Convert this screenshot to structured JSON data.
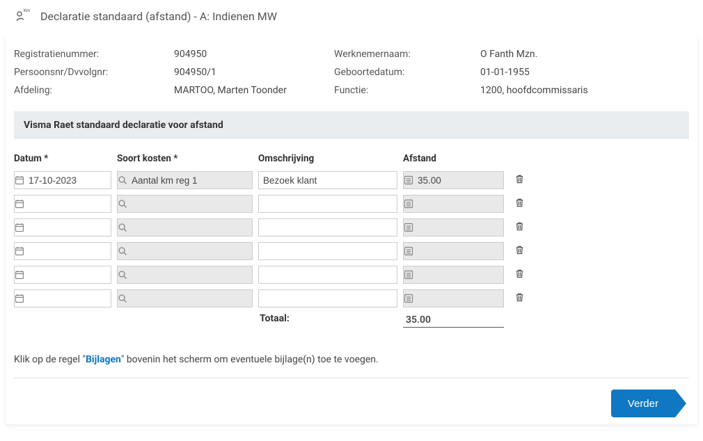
{
  "header": {
    "title": "Declaratie standaard (afstand) - A: Indienen MW"
  },
  "meta": {
    "regnr_label": "Registratienummer:",
    "regnr_value": "904950",
    "persnr_label": "Persoonsnr/Dvvolgnr:",
    "persnr_value": "904950/1",
    "afdeling_label": "Afdeling:",
    "afdeling_value": "MARTOO, Marten Toonder",
    "werknaam_label": "Werknemernaam:",
    "werknaam_value": "O Fanth Mzn.",
    "gebdat_label": "Geboortedatum:",
    "gebdat_value": "01-01-1955",
    "functie_label": "Functie:",
    "functie_value": "1200, hoofdcommissaris"
  },
  "section_title": "Visma Raet standaard declaratie voor afstand",
  "columns": {
    "datum": "Datum *",
    "soort": "Soort kosten *",
    "omschr": "Omschrijving",
    "afstand": "Afstand"
  },
  "rows": [
    {
      "datum": "17-10-2023",
      "soort": "Aantal km reg 1",
      "omschr": "Bezoek klant",
      "afstand": "35.00"
    },
    {
      "datum": "",
      "soort": "",
      "omschr": "",
      "afstand": ""
    },
    {
      "datum": "",
      "soort": "",
      "omschr": "",
      "afstand": ""
    },
    {
      "datum": "",
      "soort": "",
      "omschr": "",
      "afstand": ""
    },
    {
      "datum": "",
      "soort": "",
      "omschr": "",
      "afstand": ""
    },
    {
      "datum": "",
      "soort": "",
      "omschr": "",
      "afstand": ""
    }
  ],
  "total_label": "Totaal:",
  "total_value": "35.00",
  "hint_pre": "Klik op de regel \"",
  "hint_link": "Bijlagen",
  "hint_post": "\" bovenin het scherm om eventuele bijlage(n) toe te voegen.",
  "verder_label": "Verder"
}
